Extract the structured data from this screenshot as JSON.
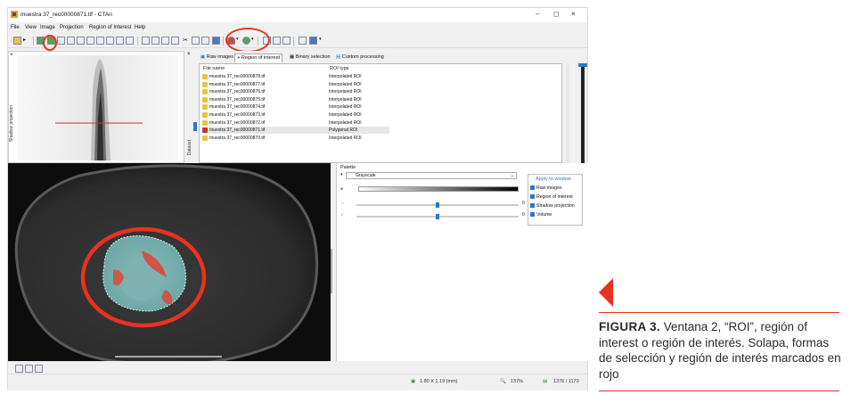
{
  "window": {
    "title": "muestra 37_rec00000871.tif - CTAn",
    "controls": [
      "–",
      "◻",
      "×"
    ]
  },
  "menu": [
    "File",
    "View",
    "Image",
    "Projection",
    "Region of Interest",
    "Help"
  ],
  "side_labels": {
    "shadow": "Shadow projection",
    "dataset": "Dataset"
  },
  "tabs": [
    "Raw images",
    "Region of interest",
    "Binary selection",
    "Custom processing"
  ],
  "file_list": {
    "columns": [
      "File name",
      "ROI type"
    ],
    "rows": [
      {
        "name": "muestra 37_rec00000878.tif",
        "type": "Interpolated ROI",
        "icon": "yellow"
      },
      {
        "name": "muestra 37_rec00000877.tif",
        "type": "Interpolated ROI",
        "icon": "yellow"
      },
      {
        "name": "muestra 37_rec00000876.tif",
        "type": "Interpolated ROI",
        "icon": "yellow"
      },
      {
        "name": "muestra 37_rec00000875.tif",
        "type": "Interpolated ROI",
        "icon": "yellow"
      },
      {
        "name": "muestra 37_rec00000874.tif",
        "type": "Interpolated ROI",
        "icon": "yellow"
      },
      {
        "name": "muestra 37_rec00000873.tif",
        "type": "Interpolated ROI",
        "icon": "yellow"
      },
      {
        "name": "muestra 37_rec00000872.tif",
        "type": "Interpolated ROI",
        "icon": "yellow"
      },
      {
        "name": "muestra 37_rec00000871.tif",
        "type": "Polygonal ROI",
        "icon": "red"
      },
      {
        "name": "muestra 37_rec00000870.tif",
        "type": "Interpolated ROI",
        "icon": "yellow"
      }
    ]
  },
  "palette": {
    "header": "Palette",
    "selected": "Grayscale",
    "slider1_value": "0",
    "slider2_value": "0",
    "slider1_pos": 0.5,
    "slider2_pos": 0.5,
    "apply": {
      "title": "Apply to window",
      "options": [
        "Raw images",
        "Region of interest",
        "Shadow projection",
        "Volume"
      ]
    }
  },
  "status": {
    "size": "1.80 X 1.19 (mm)",
    "zoom": "137%",
    "frame": "1376 / 1170"
  },
  "caption": {
    "label": "FIGURA 3.",
    "text": " Ventana 2, “ROI”, región of interest o región de interés. Solapa, formas de selección y región de interés marcados en rojo"
  },
  "colors": {
    "highlight": "#e8321f",
    "selection_blue": "#2a78c8"
  }
}
